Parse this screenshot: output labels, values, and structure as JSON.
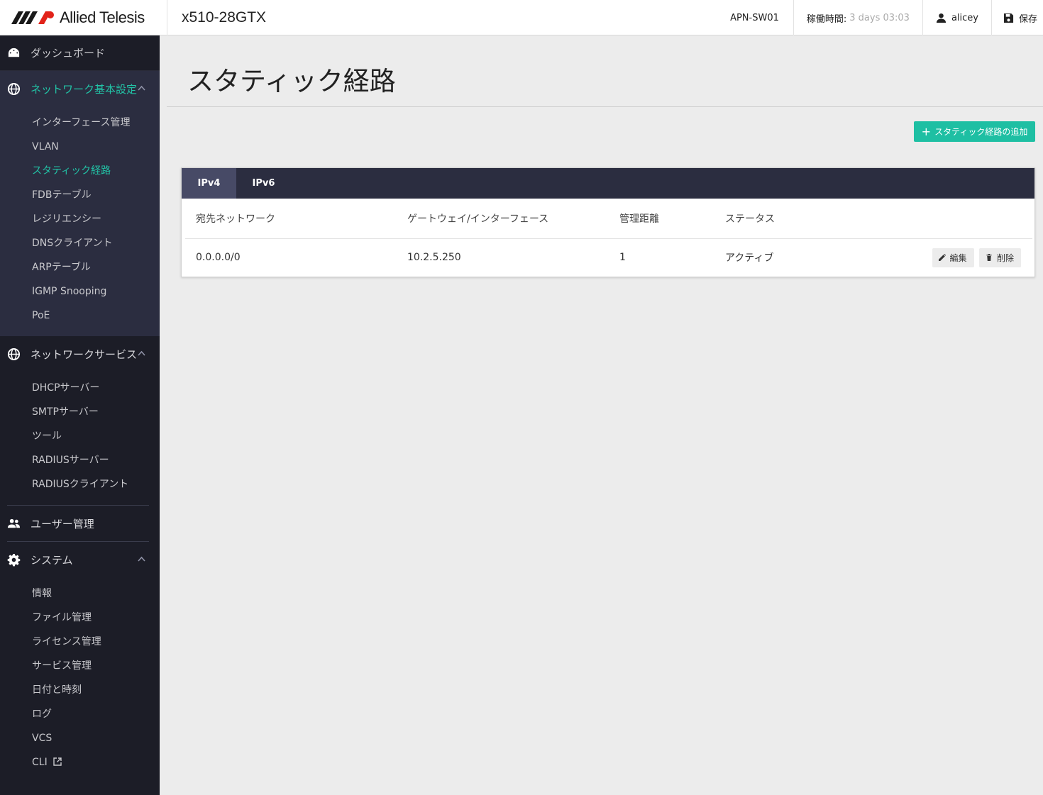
{
  "header": {
    "brand": "Allied Telesis",
    "model": "x510-28GTX",
    "hostname": "APN-SW01",
    "uptime_label": "稼働時間:",
    "uptime_value": "3 days 03:03",
    "user": "alicey",
    "save_label": "保存"
  },
  "sidebar": {
    "dashboard": "ダッシュボード",
    "network_basic": {
      "label": "ネットワーク基本設定",
      "items": [
        "インターフェース管理",
        "VLAN",
        "スタティック経路",
        "FDBテーブル",
        "レジリエンシー",
        "DNSクライアント",
        "ARPテーブル",
        "IGMP Snooping",
        "PoE"
      ]
    },
    "network_services": {
      "label": "ネットワークサービス",
      "items": [
        "DHCPサーバー",
        "SMTPサーバー",
        "ツール",
        "RADIUSサーバー",
        "RADIUSクライアント"
      ]
    },
    "user_management": "ユーザー管理",
    "system": {
      "label": "システム",
      "items": [
        "情報",
        "ファイル管理",
        "ライセンス管理",
        "サービス管理",
        "日付と時刻",
        "ログ",
        "VCS",
        "CLI"
      ]
    }
  },
  "main": {
    "title": "スタティック経路",
    "add_button": "スタティック経路の追加",
    "tabs": [
      "IPv4",
      "IPv6"
    ],
    "columns": [
      "宛先ネットワーク",
      "ゲートウェイ/インターフェース",
      "管理距離",
      "ステータス"
    ],
    "rows": [
      {
        "destination": "0.0.0.0/0",
        "gateway": "10.2.5.250",
        "distance": "1",
        "status": "アクティブ"
      }
    ],
    "edit_label": "編集",
    "delete_label": "削除"
  },
  "colors": {
    "accent": "#1ebfa3",
    "sidebar_bg": "#1c1d27",
    "sidebar_section_bg": "#2b2d40",
    "tab_active_bg": "#474a66"
  }
}
